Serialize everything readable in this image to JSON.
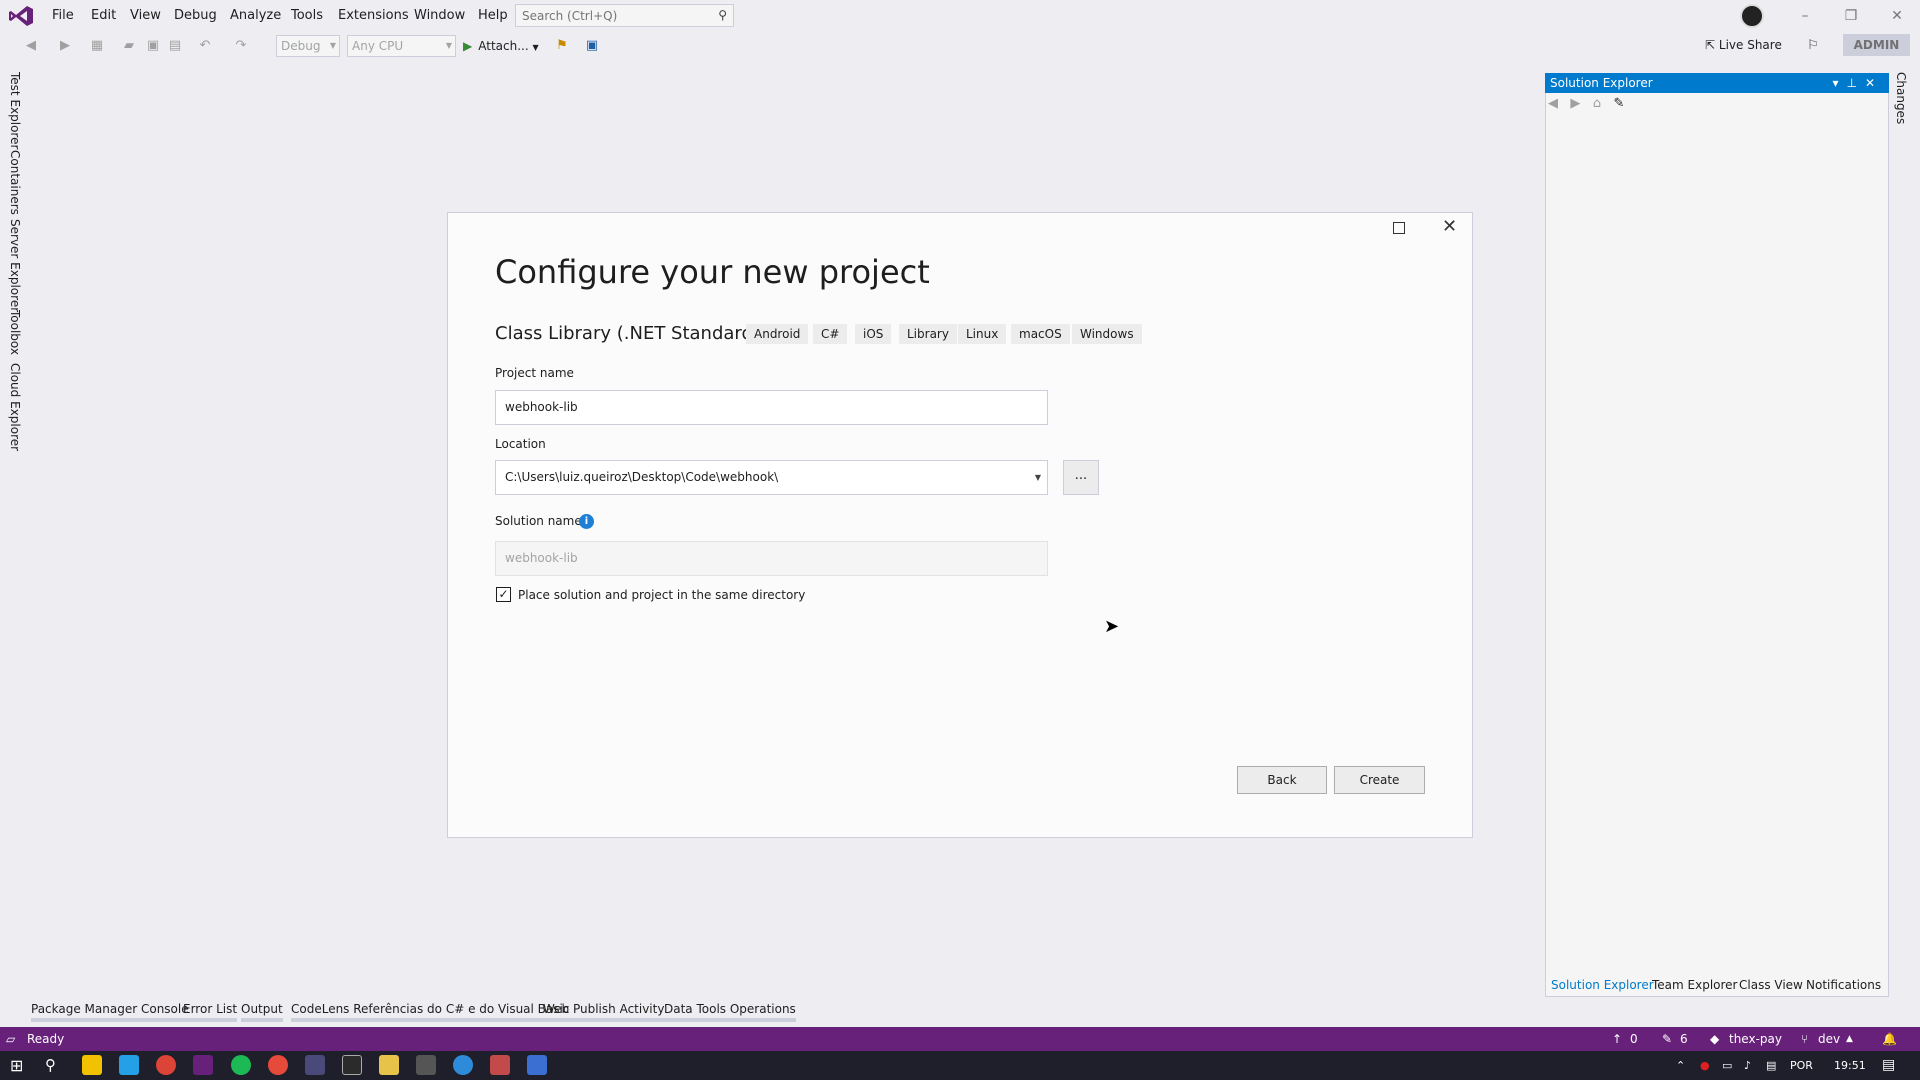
{
  "menu": {
    "items": [
      "File",
      "Edit",
      "View",
      "Debug",
      "Analyze",
      "Tools",
      "Extensions",
      "Window",
      "Help"
    ],
    "search_placeholder": "Search (Ctrl+Q)"
  },
  "toolbar": {
    "config": "Debug",
    "platform": "Any CPU",
    "attach": "Attach...",
    "live_share": "Live Share",
    "admin": "ADMIN"
  },
  "left_tabs": [
    "Test Explorer",
    "Containers",
    "Server Explorer",
    "Toolbox",
    "Cloud Explorer"
  ],
  "solution_explorer": {
    "title": "Solution Explorer",
    "bottom_tabs": [
      "Solution Explorer",
      "Team Explorer",
      "Class View",
      "Notifications"
    ],
    "side_tab": "Changes"
  },
  "tool_tabs": [
    "Package Manager Console",
    "Error List",
    "Output",
    "CodeLens Referências do C# e do Visual Basic",
    "Web Publish Activity",
    "Data Tools Operations"
  ],
  "status": {
    "ready": "Ready",
    "up_count": "0",
    "edit_count": "6",
    "repo": "thex-pay",
    "branch": "dev"
  },
  "taskbar": {
    "lang": "POR",
    "time": "19:51"
  },
  "dialog": {
    "title": "Configure your new project",
    "template": "Class Library (.NET Standard)",
    "tags": [
      "Android",
      "C#",
      "iOS",
      "Library",
      "Linux",
      "macOS",
      "Windows"
    ],
    "project_name_label": "Project name",
    "project_name": "webhook-lib",
    "location_label": "Location",
    "location": "C:\\Users\\luiz.queiroz\\Desktop\\Code\\webhook\\",
    "browse": "...",
    "solution_name_label": "Solution name",
    "solution_name": "webhook-lib",
    "same_dir_label": "Place solution and project in the same directory",
    "same_dir_checked": true,
    "back": "Back",
    "create": "Create"
  }
}
